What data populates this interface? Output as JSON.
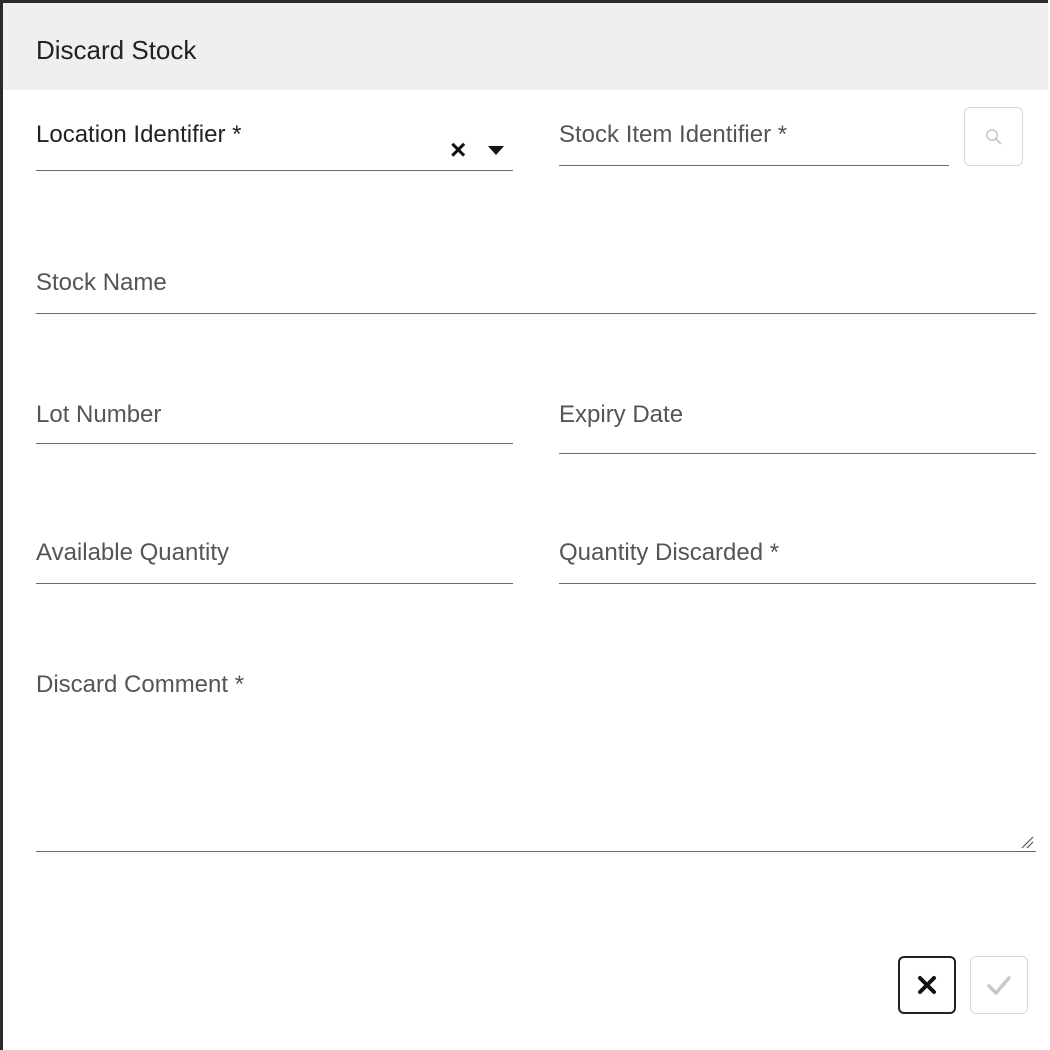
{
  "dialog": {
    "title": "Discard Stock"
  },
  "fields": {
    "location_identifier": {
      "label": "Location Identifier *",
      "value": ""
    },
    "stock_item_identifier": {
      "label": "Stock Item Identifier *",
      "value": ""
    },
    "stock_name": {
      "label": "Stock Name",
      "value": ""
    },
    "lot_number": {
      "label": "Lot Number",
      "value": ""
    },
    "expiry_date": {
      "label": "Expiry Date",
      "value": ""
    },
    "available_quantity": {
      "label": "Available Quantity",
      "value": ""
    },
    "quantity_discarded": {
      "label": "Quantity Discarded *",
      "value": ""
    },
    "discard_comment": {
      "label": "Discard Comment *",
      "value": ""
    }
  },
  "icons": {
    "clear": "close-icon",
    "dropdown": "caret-down-icon",
    "search": "search-icon",
    "resize": "resize-handle-icon",
    "cancel": "close-icon",
    "confirm": "check-icon"
  },
  "colors": {
    "titlebar_bg": "#efefef",
    "underline": "#6b6b6b",
    "label": "#555555",
    "disabled_border": "#d8d8d8",
    "disabled_icon": "#c8c8c8"
  }
}
